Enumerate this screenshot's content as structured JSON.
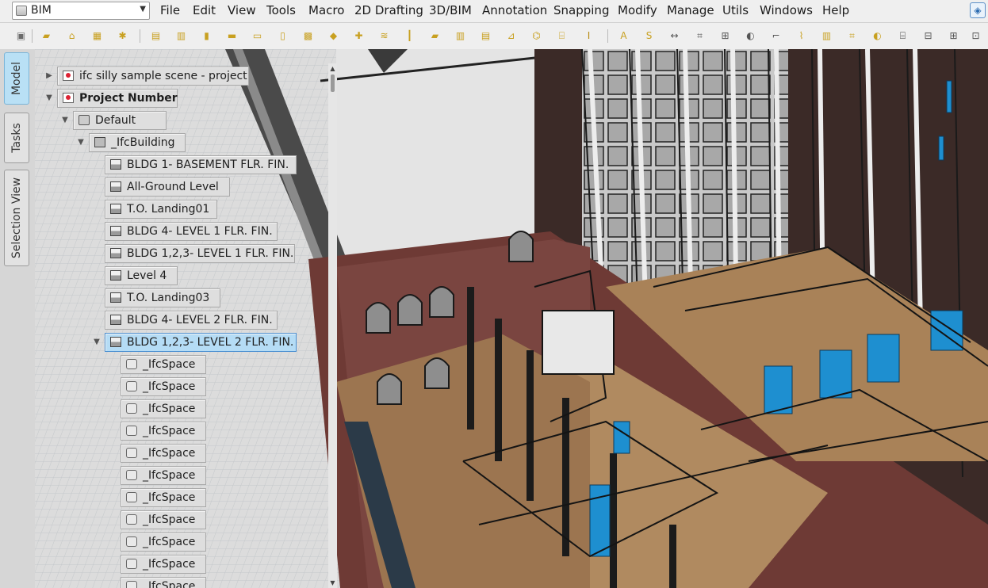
{
  "workbench": {
    "label": "BIM",
    "icon": "workbench-icon"
  },
  "menu": [
    "File",
    "Edit",
    "View",
    "Tools",
    "Macro",
    "2D Drafting",
    "3D/BIM",
    "Annotation",
    "Snapping",
    "Modify",
    "Manage",
    "Utils",
    "Windows",
    "Help"
  ],
  "toolbar_icons": [
    "project-icon",
    "wall-icon",
    "structure-icon",
    "site-icon",
    "building-part-icon",
    "slab-icon",
    "stairs-icon",
    "column-icon",
    "beam-icon",
    "panel-icon",
    "door-icon",
    "window-icon",
    "roof-icon",
    "frame-icon",
    "curtain-wall-icon",
    "pipe-icon",
    "folder-icon",
    "fence-icon",
    "railing-icon",
    "truss-icon",
    "profile-icon",
    "equipment-icon",
    "rebar-icon",
    "text-icon",
    "shape-string-icon",
    "dimension-icon",
    "axis-icon",
    "grid-icon",
    "section-plane-icon",
    "cut-line-icon",
    "material-icon",
    "schedule-icon",
    "space-icon",
    "reference-icon",
    "survey-icon",
    "ifc-explorer-icon",
    "tree-view-icon",
    "drawing-view-icon"
  ],
  "side_tabs": {
    "model": "Model",
    "tasks": "Tasks",
    "selection": "Selection View"
  },
  "tree": {
    "nodes": [
      {
        "label": "ifc silly sample scene - project",
        "icon": "ifc-document-icon",
        "expander": "collapsed"
      },
      {
        "label": "Project Number",
        "icon": "ifc-document-icon",
        "expander": "expanded",
        "bold": true
      },
      {
        "label": "Default",
        "icon": "site-icon",
        "expander": "expanded"
      },
      {
        "label": "_IfcBuilding",
        "icon": "building-icon",
        "expander": "expanded"
      },
      {
        "label": "BLDG 1- BASEMENT FLR. FIN.",
        "icon": "building-part-icon"
      },
      {
        "label": "All-Ground Level",
        "icon": "building-part-icon"
      },
      {
        "label": "T.O. Landing01",
        "icon": "building-part-icon"
      },
      {
        "label": "BLDG 4- LEVEL 1 FLR. FIN.",
        "icon": "building-part-icon"
      },
      {
        "label": "BLDG 1,2,3- LEVEL 1 FLR. FIN.",
        "icon": "building-part-icon"
      },
      {
        "label": "Level 4",
        "icon": "building-part-icon"
      },
      {
        "label": "T.O. Landing03",
        "icon": "building-part-icon"
      },
      {
        "label": "BLDG 4- LEVEL 2 FLR. FIN.",
        "icon": "building-part-icon"
      },
      {
        "label": "BLDG 1,2,3- LEVEL 2 FLR. FIN.",
        "icon": "building-part-icon",
        "expander": "expanded",
        "selected": true
      },
      {
        "label": "_IfcSpace",
        "icon": "space-icon"
      },
      {
        "label": "_IfcSpace",
        "icon": "space-icon"
      },
      {
        "label": "_IfcSpace",
        "icon": "space-icon"
      },
      {
        "label": "_IfcSpace",
        "icon": "space-icon"
      },
      {
        "label": "_IfcSpace",
        "icon": "space-icon"
      },
      {
        "label": "_IfcSpace",
        "icon": "space-icon"
      },
      {
        "label": "_IfcSpace",
        "icon": "space-icon"
      },
      {
        "label": "_IfcSpace",
        "icon": "space-icon"
      },
      {
        "label": "_IfcSpace",
        "icon": "space-icon"
      },
      {
        "label": "_IfcSpace",
        "icon": "space-icon"
      },
      {
        "label": "_IfcSpace",
        "icon": "space-icon"
      }
    ]
  },
  "colors": {
    "selection": "#b5dcf5",
    "accent": "#1e8fd0",
    "brick": "#6e3a35",
    "floor": "#b08a60"
  }
}
